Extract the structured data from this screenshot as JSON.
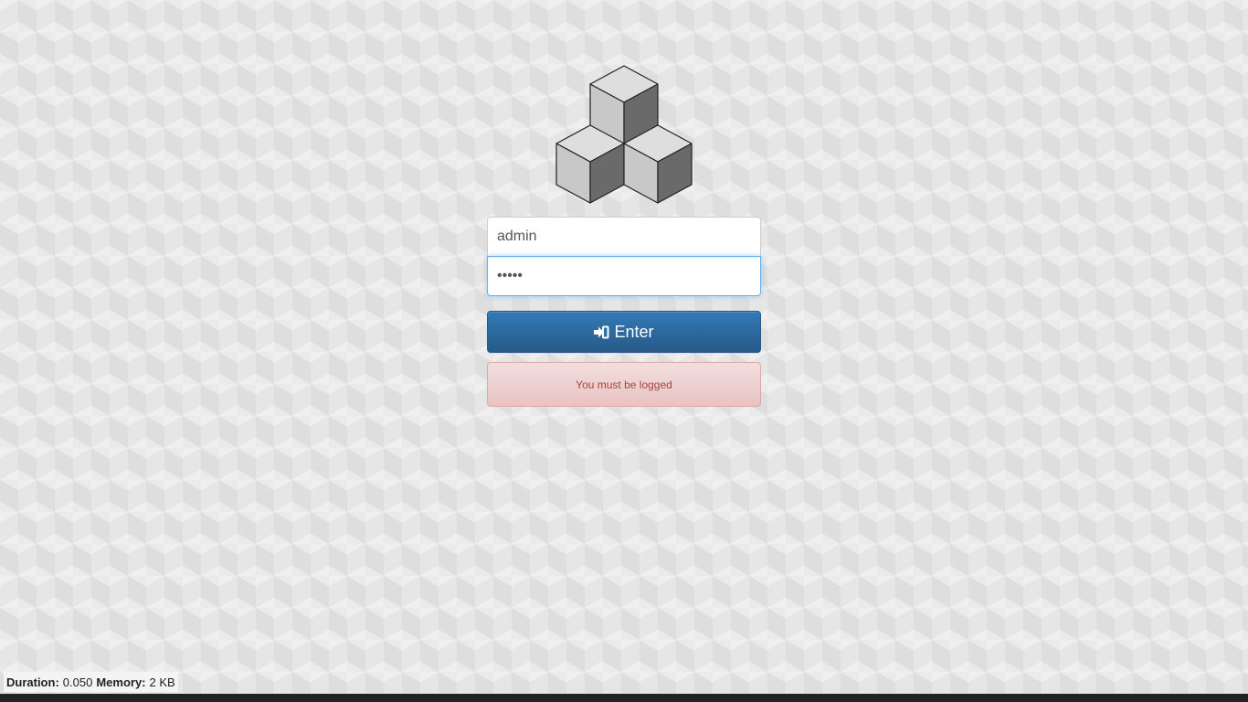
{
  "logo": {
    "icon": "cubes-logo-icon"
  },
  "login": {
    "username_value": "admin",
    "password_value": "•••••",
    "enter_label": "Enter",
    "enter_icon": "sign-in-icon"
  },
  "alert": {
    "message": "You must be logged"
  },
  "debug": {
    "duration_label": "Duration:",
    "duration_value": "0.050",
    "memory_label": "Memory:",
    "memory_value": "2 KB"
  },
  "colors": {
    "button_top": "#337ab7",
    "button_bottom": "#265a88",
    "alert_text": "#a94442",
    "alert_bg": "#f2dede",
    "focus_border": "#66afe9"
  }
}
